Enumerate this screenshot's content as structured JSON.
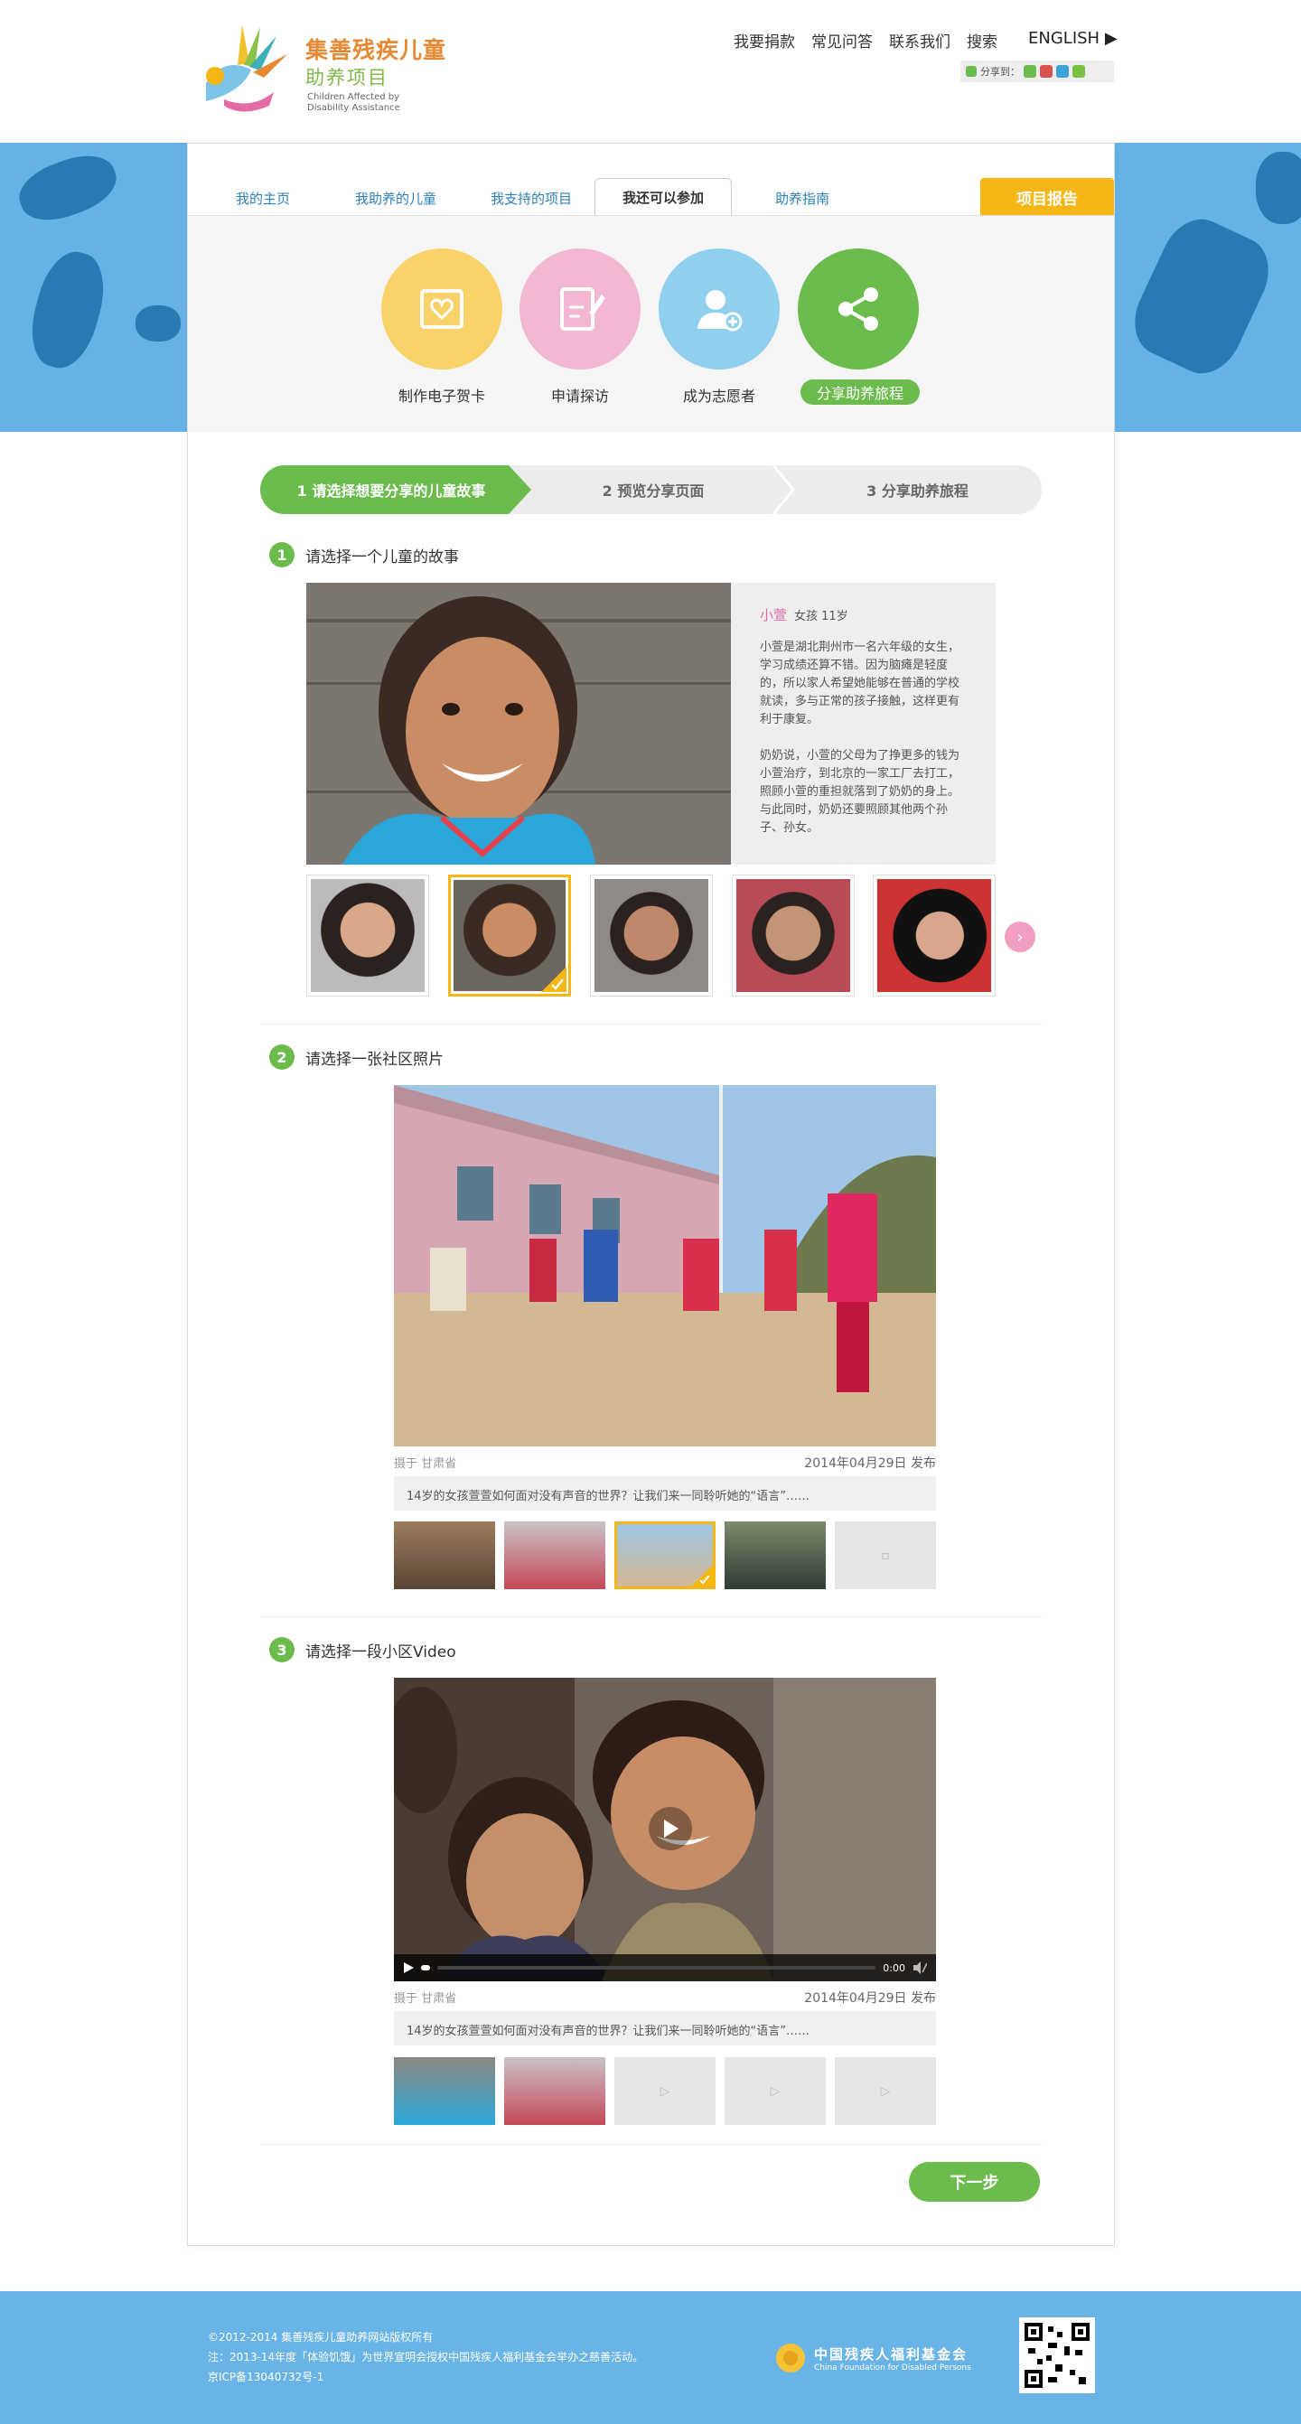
{
  "header": {
    "logo": {
      "text_line1": "集善残疾儿童",
      "text_line2": "助养项目",
      "text_en": "Children Affected by Disability Assistance"
    },
    "nav": [
      "我要捐款",
      "常见问答",
      "联系我们",
      "搜索"
    ],
    "english_label": "ENGLISH",
    "share_label": "分享到："
  },
  "tabs": [
    {
      "label": "我的主页"
    },
    {
      "label": "我助养的儿童"
    },
    {
      "label": "我支持的项目"
    },
    {
      "label": "我还可以参加"
    },
    {
      "label": "助养指南"
    }
  ],
  "report_label": "项目报告",
  "actions": [
    {
      "label": "制作电子贺卡",
      "color": "#f9d26a"
    },
    {
      "label": "申请探访",
      "color": "#f2b7d2"
    },
    {
      "label": "成为志愿者",
      "color": "#8fd0ef"
    },
    {
      "label": "分享助养旅程",
      "color": "#6bbc4c"
    }
  ],
  "steps": [
    "1 请选择想要分享的儿童故事",
    "2 预览分享页面",
    "3 分享助养旅程"
  ],
  "section1": {
    "num": "1",
    "title": "请选择一个儿童的故事",
    "child_name": "小萱",
    "child_info": "女孩  11岁",
    "para1": "小萱是湖北荆州市一名六年级的女生，学习成绩还算不错。因为脑瘫是轻度的，所以家人希望她能够在普通的学校就读，多与正常的孩子接触，这样更有利于康复。",
    "para2": "奶奶说，小萱的父母为了挣更多的钱为小萱治疗，到北京的一家工厂去打工，照顾小萱的重担就落到了奶奶的身上。与此同时，奶奶还要照顾其他两个孙子、孙女。"
  },
  "section2": {
    "num": "2",
    "title": "请选择一张社区照片",
    "location": "摄于 甘肃省",
    "date": "2014年04月29日 发布",
    "caption": "14岁的女孩萱萱如何面对没有声音的世界？让我们来一同聆听她的“语言”……"
  },
  "section3": {
    "num": "3",
    "title": "请选择一段小区Video",
    "location": "摄于 甘肃省",
    "date": "2014年04月29日 发布",
    "caption": "14岁的女孩萱萱如何面对没有声音的世界？让我们来一同聆听她的“语言”……",
    "time": "0:00"
  },
  "next_label": "下一步",
  "footer": {
    "line1": "©2012-2014 集善残疾儿童助养网站版权所有",
    "line2": "注：2013-14年度「体验饥饿」为世界宣明会授权中国残疾人福利基金会举办之慈善活动。",
    "line3": "京ICP备13040732号-1",
    "foundation_cn": "中国残疾人福利基金会",
    "foundation_en": "China Foundation for Disabled Persons"
  }
}
